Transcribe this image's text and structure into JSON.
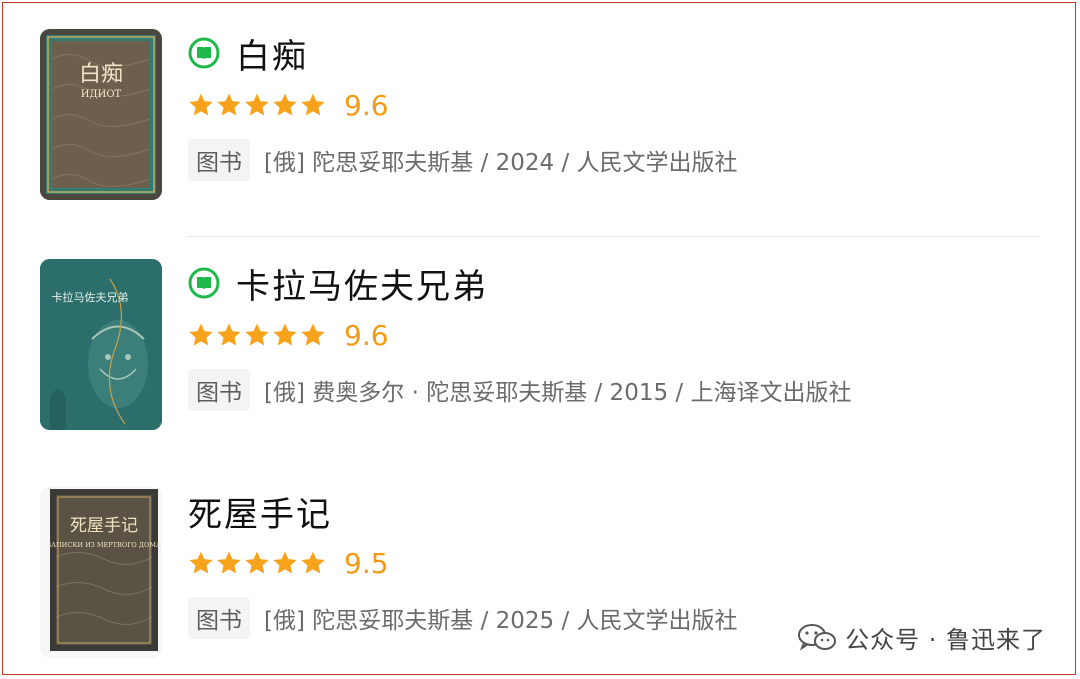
{
  "books": [
    {
      "title": "白痴",
      "rating": "9.6",
      "stars": 5,
      "tag": "图书",
      "meta": "[俄] 陀思妥耶夫斯基 / 2024 / 人民文学出版社",
      "cover_title": "白痴",
      "cover_subtitle": "ИДИОТ",
      "has_read_icon": true
    },
    {
      "title": "卡拉马佐夫兄弟",
      "rating": "9.6",
      "stars": 5,
      "tag": "图书",
      "meta": "[俄] 费奥多尔 · 陀思妥耶夫斯基 / 2015 / 上海译文出版社",
      "cover_title": "卡拉马佐夫兄弟",
      "has_read_icon": true
    },
    {
      "title": "死屋手记",
      "rating": "9.5",
      "stars": 5,
      "tag": "图书",
      "meta": "[俄] 陀思妥耶夫斯基 / 2025 / 人民文学出版社",
      "cover_title": "死屋手记",
      "cover_subtitle": "ЗАПИСКИ ИЗ МЕРТВОГО ДОМА",
      "has_read_icon": false
    }
  ],
  "watermark": {
    "text": "公众号 · 鲁迅来了",
    "icon": "wechat-icon"
  },
  "colors": {
    "star": "#f7a21b",
    "score": "#f29b13",
    "read_icon": "#1fb84b",
    "border": "#c0392b"
  }
}
